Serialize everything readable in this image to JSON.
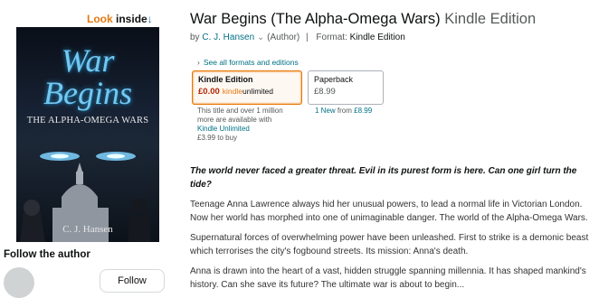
{
  "look_inside": {
    "part1": "Look",
    "part2": "inside",
    "arrow": "↓"
  },
  "cover": {
    "title_line1": "War",
    "title_line2": "Begins",
    "subtitle": "THE ALPHA-OMEGA WARS",
    "author": "C. J. Hansen",
    "accent_color": "#74c8f0"
  },
  "follow": {
    "heading": "Follow the author",
    "button": "Follow"
  },
  "product": {
    "title": "War Begins (The Alpha-Omega Wars)",
    "format_suffix": "Kindle Edition",
    "by_prefix": "by",
    "author": "C. J. Hansen",
    "author_role": "(Author)",
    "format_label": "Format:",
    "format_value": "Kindle Edition",
    "see_all": "See all formats and editions"
  },
  "formats": {
    "kindle": {
      "name": "Kindle Edition",
      "price": "£0.00",
      "ku_part1": "kindle",
      "ku_part2": "unlimited"
    },
    "paperback": {
      "name": "Paperback",
      "price": "£8.99"
    }
  },
  "ku_note": {
    "line1": "This title and over 1 million",
    "line2": "more are available with",
    "link": "Kindle Unlimited",
    "line3": "£3.99 to buy"
  },
  "new_from": {
    "link": "1 New",
    "from": "from",
    "price": "£8.99"
  },
  "description": {
    "lead": "The world never faced a greater threat. Evil in its purest form is here. Can one girl turn the tide?",
    "p1": "Teenage Anna Lawrence always hid her unusual powers, to lead a normal life in Victorian London. Now her world has morphed into one of unimaginable danger. The world of the Alpha-Omega Wars.",
    "p2": "Supernatural forces of overwhelming power have been unleashed. First to strike is a demonic beast which terrorises the city's fogbound streets. Its mission: Anna's death.",
    "p3": "Anna is drawn into the heart of a vast, hidden struggle spanning millennia. It has shaped mankind's history. Can she save its future? The ultimate war is about to begin..."
  }
}
